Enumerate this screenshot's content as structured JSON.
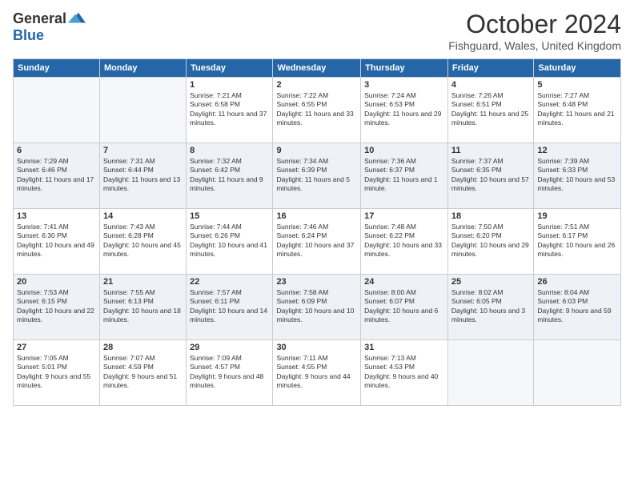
{
  "logo": {
    "general": "General",
    "blue": "Blue"
  },
  "title": {
    "month_year": "October 2024",
    "location": "Fishguard, Wales, United Kingdom"
  },
  "days_of_week": [
    "Sunday",
    "Monday",
    "Tuesday",
    "Wednesday",
    "Thursday",
    "Friday",
    "Saturday"
  ],
  "weeks": [
    [
      {
        "num": "",
        "info": ""
      },
      {
        "num": "",
        "info": ""
      },
      {
        "num": "1",
        "info": "Sunrise: 7:21 AM\nSunset: 6:58 PM\nDaylight: 11 hours and 37 minutes."
      },
      {
        "num": "2",
        "info": "Sunrise: 7:22 AM\nSunset: 6:55 PM\nDaylight: 11 hours and 33 minutes."
      },
      {
        "num": "3",
        "info": "Sunrise: 7:24 AM\nSunset: 6:53 PM\nDaylight: 11 hours and 29 minutes."
      },
      {
        "num": "4",
        "info": "Sunrise: 7:26 AM\nSunset: 6:51 PM\nDaylight: 11 hours and 25 minutes."
      },
      {
        "num": "5",
        "info": "Sunrise: 7:27 AM\nSunset: 6:48 PM\nDaylight: 11 hours and 21 minutes."
      }
    ],
    [
      {
        "num": "6",
        "info": "Sunrise: 7:29 AM\nSunset: 6:46 PM\nDaylight: 11 hours and 17 minutes."
      },
      {
        "num": "7",
        "info": "Sunrise: 7:31 AM\nSunset: 6:44 PM\nDaylight: 11 hours and 13 minutes."
      },
      {
        "num": "8",
        "info": "Sunrise: 7:32 AM\nSunset: 6:42 PM\nDaylight: 11 hours and 9 minutes."
      },
      {
        "num": "9",
        "info": "Sunrise: 7:34 AM\nSunset: 6:39 PM\nDaylight: 11 hours and 5 minutes."
      },
      {
        "num": "10",
        "info": "Sunrise: 7:36 AM\nSunset: 6:37 PM\nDaylight: 11 hours and 1 minute."
      },
      {
        "num": "11",
        "info": "Sunrise: 7:37 AM\nSunset: 6:35 PM\nDaylight: 10 hours and 57 minutes."
      },
      {
        "num": "12",
        "info": "Sunrise: 7:39 AM\nSunset: 6:33 PM\nDaylight: 10 hours and 53 minutes."
      }
    ],
    [
      {
        "num": "13",
        "info": "Sunrise: 7:41 AM\nSunset: 6:30 PM\nDaylight: 10 hours and 49 minutes."
      },
      {
        "num": "14",
        "info": "Sunrise: 7:43 AM\nSunset: 6:28 PM\nDaylight: 10 hours and 45 minutes."
      },
      {
        "num": "15",
        "info": "Sunrise: 7:44 AM\nSunset: 6:26 PM\nDaylight: 10 hours and 41 minutes."
      },
      {
        "num": "16",
        "info": "Sunrise: 7:46 AM\nSunset: 6:24 PM\nDaylight: 10 hours and 37 minutes."
      },
      {
        "num": "17",
        "info": "Sunrise: 7:48 AM\nSunset: 6:22 PM\nDaylight: 10 hours and 33 minutes."
      },
      {
        "num": "18",
        "info": "Sunrise: 7:50 AM\nSunset: 6:20 PM\nDaylight: 10 hours and 29 minutes."
      },
      {
        "num": "19",
        "info": "Sunrise: 7:51 AM\nSunset: 6:17 PM\nDaylight: 10 hours and 26 minutes."
      }
    ],
    [
      {
        "num": "20",
        "info": "Sunrise: 7:53 AM\nSunset: 6:15 PM\nDaylight: 10 hours and 22 minutes."
      },
      {
        "num": "21",
        "info": "Sunrise: 7:55 AM\nSunset: 6:13 PM\nDaylight: 10 hours and 18 minutes."
      },
      {
        "num": "22",
        "info": "Sunrise: 7:57 AM\nSunset: 6:11 PM\nDaylight: 10 hours and 14 minutes."
      },
      {
        "num": "23",
        "info": "Sunrise: 7:58 AM\nSunset: 6:09 PM\nDaylight: 10 hours and 10 minutes."
      },
      {
        "num": "24",
        "info": "Sunrise: 8:00 AM\nSunset: 6:07 PM\nDaylight: 10 hours and 6 minutes."
      },
      {
        "num": "25",
        "info": "Sunrise: 8:02 AM\nSunset: 6:05 PM\nDaylight: 10 hours and 3 minutes."
      },
      {
        "num": "26",
        "info": "Sunrise: 8:04 AM\nSunset: 6:03 PM\nDaylight: 9 hours and 59 minutes."
      }
    ],
    [
      {
        "num": "27",
        "info": "Sunrise: 7:05 AM\nSunset: 5:01 PM\nDaylight: 9 hours and 55 minutes."
      },
      {
        "num": "28",
        "info": "Sunrise: 7:07 AM\nSunset: 4:59 PM\nDaylight: 9 hours and 51 minutes."
      },
      {
        "num": "29",
        "info": "Sunrise: 7:09 AM\nSunset: 4:57 PM\nDaylight: 9 hours and 48 minutes."
      },
      {
        "num": "30",
        "info": "Sunrise: 7:11 AM\nSunset: 4:55 PM\nDaylight: 9 hours and 44 minutes."
      },
      {
        "num": "31",
        "info": "Sunrise: 7:13 AM\nSunset: 4:53 PM\nDaylight: 9 hours and 40 minutes."
      },
      {
        "num": "",
        "info": ""
      },
      {
        "num": "",
        "info": ""
      }
    ]
  ]
}
